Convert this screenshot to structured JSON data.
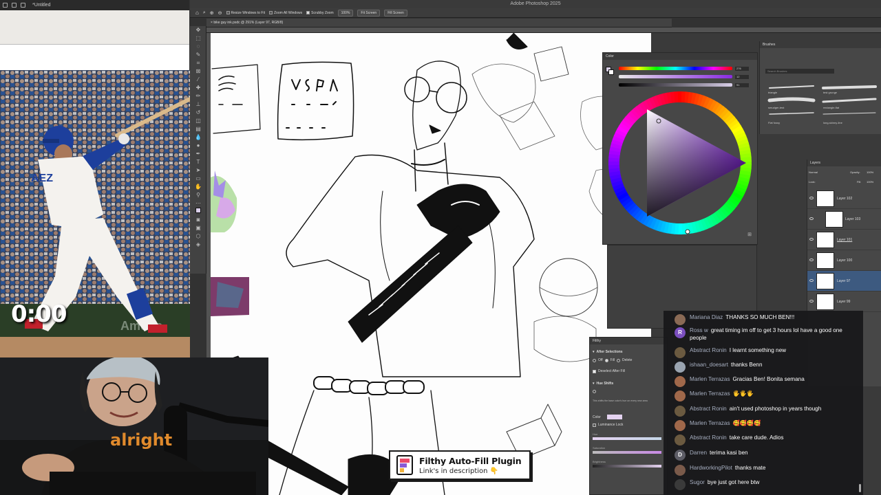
{
  "reference_window": {
    "title": "*Untitled"
  },
  "timer": "0:00",
  "photoshop": {
    "app_title": "Adobe Photoshop 2025",
    "options_bar": {
      "resize_windows": "Resize Windows to Fit",
      "zoom_all_windows": "Zoom All Windows",
      "scrubby_zoom": "Scrubby Zoom",
      "zoom_value": "100%",
      "fit_screen": "Fit Screen",
      "fill_screen": "Fill Screen"
    },
    "document_tab": "bike guy ink.psdc @ 291% (Layer 97, RGB/8)",
    "color_panel": {
      "title": "Color",
      "h": "276",
      "s": "12",
      "b": "91"
    },
    "brushes_panel": {
      "title": "Brushes",
      "search_placeholder": "Search Brushes",
      "brush_names": [
        "triangle",
        "test grunge",
        "smudger-test",
        "rectangle-flat",
        "Flat fussy",
        "long-skinny-line"
      ]
    },
    "layers_panel": {
      "title": "Layers",
      "blend_mode": "Normal",
      "opacity_label": "Opacity:",
      "opacity_value": "100%",
      "lock_label": "Lock:",
      "fill_label": "Fill:",
      "fill_value": "100%",
      "layers": [
        "Layer 102",
        "Layer 103",
        "Layer 101",
        "Layer 100",
        "Layer 97",
        "Layer 99"
      ]
    },
    "filthy_panel": {
      "title": "Filthy",
      "after_selections": "After Selections",
      "opt_off": "Off",
      "opt_fill": "Fill",
      "opt_delete": "Delete",
      "deselect_after_fill": "Deselect After Fill",
      "hue_shifts": "Hue Shifts",
      "hue_desc": "This shifts the base color's hue on every new area",
      "color_label": "Color",
      "luminance_lock": "Luminance Lock",
      "hue_label": "Hue",
      "saturation_label": "Saturation",
      "brightness_label": "Brightness"
    }
  },
  "chat": [
    {
      "author": "Mariana Diaz",
      "text": "THANKS SO MUCH BEN!!!",
      "avatar_color": "#8a6a55",
      "initial": ""
    },
    {
      "author": "Ross w",
      "text": "great timing im off to get 3 hours lol have a good one people",
      "avatar_color": "#7b4fbf",
      "initial": "R"
    },
    {
      "author": "Abstract Ronin",
      "text": "I learnt something new",
      "avatar_color": "#6b5a40",
      "initial": ""
    },
    {
      "author": "ishaan_doesart",
      "text": "thanks Benn",
      "avatar_color": "#9aa4b0",
      "initial": ""
    },
    {
      "author": "Marlen Terrazas",
      "text": "Gracias Ben! Bonita semana",
      "avatar_color": "#a0684a",
      "initial": ""
    },
    {
      "author": "Marlen Terrazas",
      "text": "🖐🖐🖐",
      "avatar_color": "#a0684a",
      "initial": ""
    },
    {
      "author": "Abstract Ronin",
      "text": "ain't used photoshop in years though",
      "avatar_color": "#6b5a40",
      "initial": ""
    },
    {
      "author": "Marlen Terrazas",
      "text": "🥰🥰🥰🥰",
      "avatar_color": "#a0684a",
      "initial": ""
    },
    {
      "author": "Abstract Ronin",
      "text": "take care dude. Adios",
      "avatar_color": "#6b5a40",
      "initial": ""
    },
    {
      "author": "Darren",
      "text": "terima kasi ben",
      "avatar_color": "#5d5d66",
      "initial": "D"
    },
    {
      "author": "HardworkingPilot",
      "text": "thanks mate",
      "avatar_color": "#7a5a4a",
      "initial": ""
    },
    {
      "author": "Sugor",
      "text": "bye just got here btw",
      "avatar_color": "#3a3a3a",
      "initial": ""
    }
  ],
  "banner": {
    "title": "Filthy Auto-Fill Plugin",
    "subtitle": "Link's in description 👇"
  },
  "webcam": {
    "shirt_text": "alright"
  }
}
